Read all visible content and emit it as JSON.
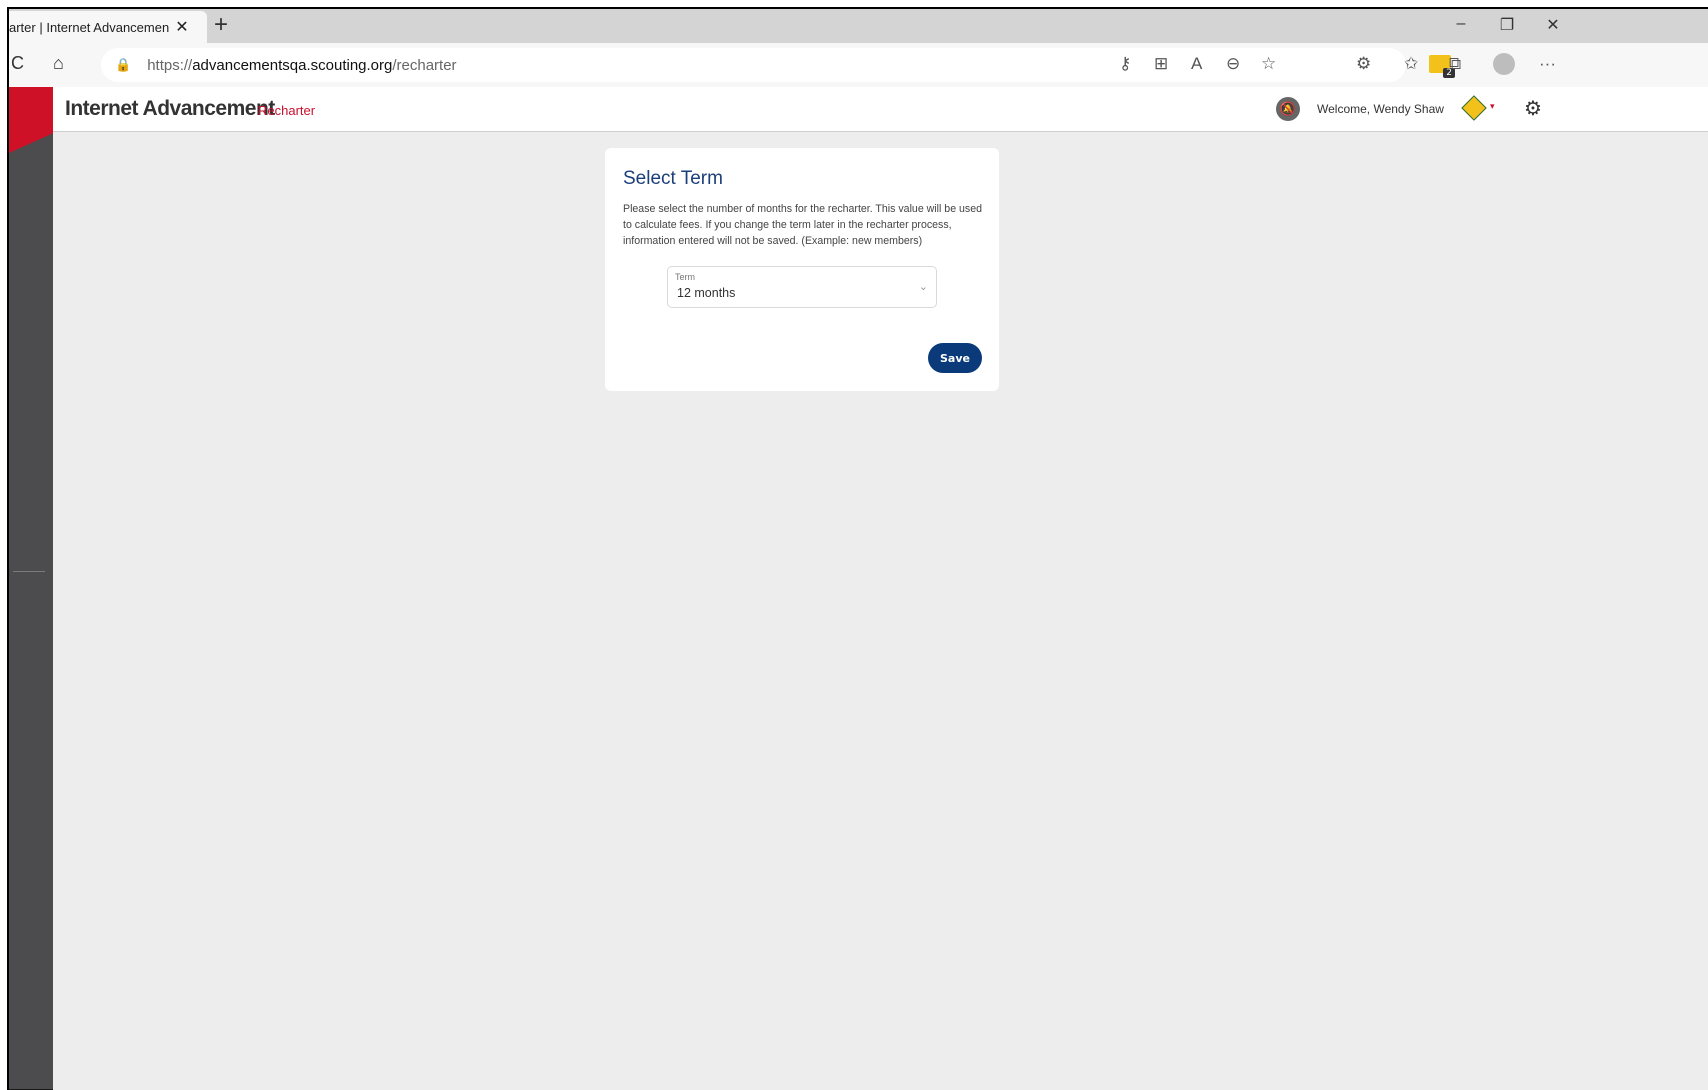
{
  "browser": {
    "tab_title": "arter | Internet Advancemen",
    "tab_close": "✕",
    "new_tab": "+",
    "url_scheme": "https://",
    "url_host": "advancementsqa.scouting.org",
    "url_path": "/recharter",
    "extension_badge_count": "2",
    "icons": {
      "refresh": "C",
      "home": "⌂",
      "lock": "🔒",
      "key": "⚷",
      "apps": "⊞",
      "read_aloud": "A",
      "zoom_out": "⊖",
      "favorite_add": "☆",
      "extensions": "⚙",
      "favorites": "✩",
      "collections": "⧉",
      "more": "···",
      "minimize": "–",
      "restore": "❐",
      "close": "✕"
    }
  },
  "app": {
    "title": "Internet Advancement",
    "subtitle": "Recharter",
    "welcome": "Welcome, Wendy Shaw",
    "notifications_icon_glyph": "🔕",
    "settings_icon_glyph": "⚙",
    "unit_caret": "▾",
    "accent_color": "#ce1126",
    "brand_blue": "#0a3a7a"
  },
  "card": {
    "title": "Select Term",
    "description": "Please select the number of months for the recharter. This value will be used to calculate fees. If you change the term later in the recharter process, information entered will not be saved. (Example: new members)",
    "term_label": "Term",
    "term_value": "12 months",
    "chevron": "⌄",
    "save_label": "Save"
  }
}
